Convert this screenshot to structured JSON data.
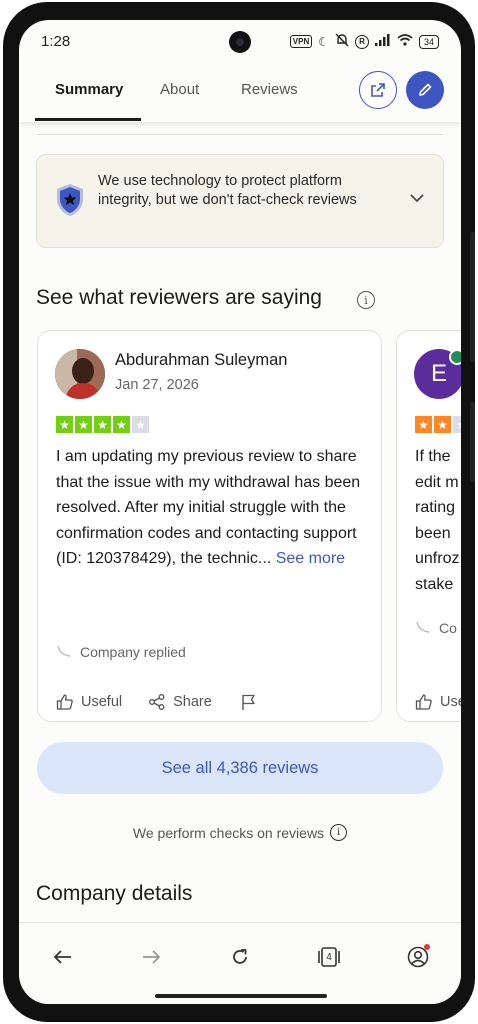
{
  "status_bar": {
    "time": "1:28",
    "vpn": "VPN",
    "r_badge": "R",
    "battery": "34"
  },
  "tabs": [
    {
      "label": "Summary",
      "active": true
    },
    {
      "label": "About",
      "active": false
    },
    {
      "label": "Reviews",
      "active": false
    }
  ],
  "banner": {
    "text": "We use technology to protect platform integrity, but we don't fact-check reviews",
    "icon": "shield-star-icon"
  },
  "section": {
    "title": "See what reviewers are saying",
    "info_icon": "i"
  },
  "review": {
    "name": "Abdurahman Suleyman",
    "date": "Jan 27, 2026",
    "rating": 4,
    "text": "I am updating my previous review to share that the issue with my withdrawal has been resolved. After my initial struggle with the confirmation codes and contacting support (ID: 120378429), the technic...",
    "see_more": "See more",
    "company_replied": "Company replied",
    "useful": "Useful",
    "share": "Share"
  },
  "review_peek": {
    "avatar_letter": "E",
    "rating": 2,
    "lines": [
      "If the",
      "edit m",
      "rating",
      "been",
      "unfroz",
      "stake"
    ],
    "replied": "Co",
    "useful": "Use"
  },
  "see_all_label": "See all 4,386 reviews",
  "checks_text": "We perform checks on reviews",
  "company_details_title": "Company details",
  "colors": {
    "accent": "#3d56c2",
    "star_green": "#73cf11",
    "star_orange": "#ff8622",
    "star_empty": "#dcdce6",
    "see_all_bg": "#dce6fb",
    "banner_bg": "#f6f4ea"
  },
  "bottom_bar": {
    "tab_count": "4"
  }
}
